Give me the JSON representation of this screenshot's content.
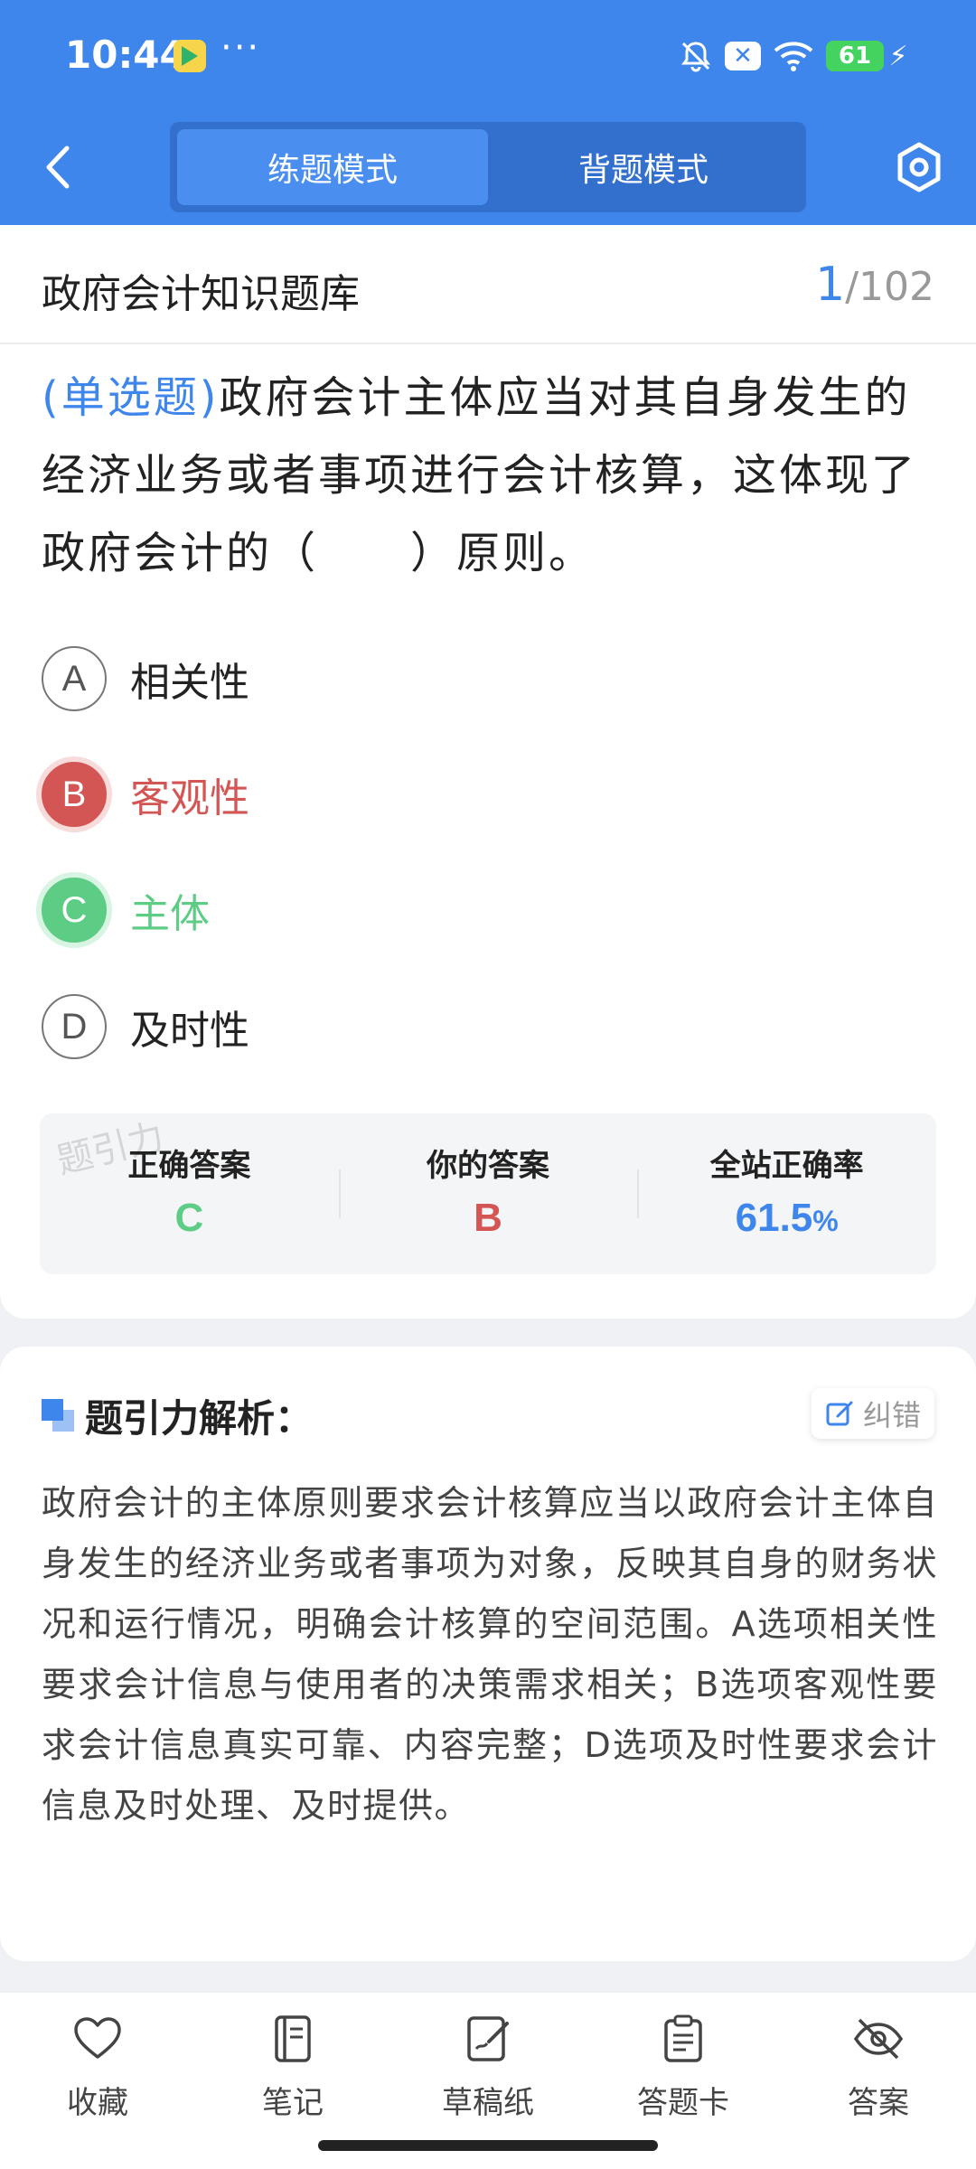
{
  "status": {
    "time": "10:44",
    "dots": "···",
    "battery": "61"
  },
  "header": {
    "tabs": [
      {
        "label": "练题模式"
      },
      {
        "label": "背题模式"
      }
    ]
  },
  "question": {
    "bank": "政府会计知识题库",
    "current": "1",
    "total": "/102",
    "type": "(单选题)",
    "text": "政府会计主体应当对其自身发生的经济业务或者事项进行会计核算，这体现了政府会计的（　　）原则。",
    "options": [
      {
        "letter": "A",
        "text": "相关性",
        "state": "normal"
      },
      {
        "letter": "B",
        "text": "客观性",
        "state": "wrong"
      },
      {
        "letter": "C",
        "text": "主体",
        "state": "correct"
      },
      {
        "letter": "D",
        "text": "及时性",
        "state": "normal"
      }
    ]
  },
  "result": {
    "correct_label": "正确答案",
    "correct_value": "C",
    "yours_label": "你的答案",
    "yours_value": "B",
    "rate_label": "全站正确率",
    "rate_value": "61.5",
    "rate_unit": "%",
    "watermark": "题引力"
  },
  "analysis": {
    "title": "题引力解析：",
    "fix_label": "纠错",
    "text": "政府会计的主体原则要求会计核算应当以政府会计主体自身发生的经济业务或者事项为对象，反映其自身的财务状况和运行情况，明确会计核算的空间范围。A选项相关性要求会计信息与使用者的决策需求相关；B选项客观性要求会计信息真实可靠、内容完整；D选项及时性要求会计信息及时处理、及时提供。"
  },
  "nav": [
    {
      "label": "收藏",
      "icon": "heart-icon"
    },
    {
      "label": "笔记",
      "icon": "notebook-icon"
    },
    {
      "label": "草稿纸",
      "icon": "draft-icon"
    },
    {
      "label": "答题卡",
      "icon": "clipboard-icon"
    },
    {
      "label": "答案",
      "icon": "eye-off-icon"
    }
  ],
  "colors": {
    "primary": "#3f86ec",
    "correct": "#5dcc84",
    "wrong": "#d45654"
  }
}
